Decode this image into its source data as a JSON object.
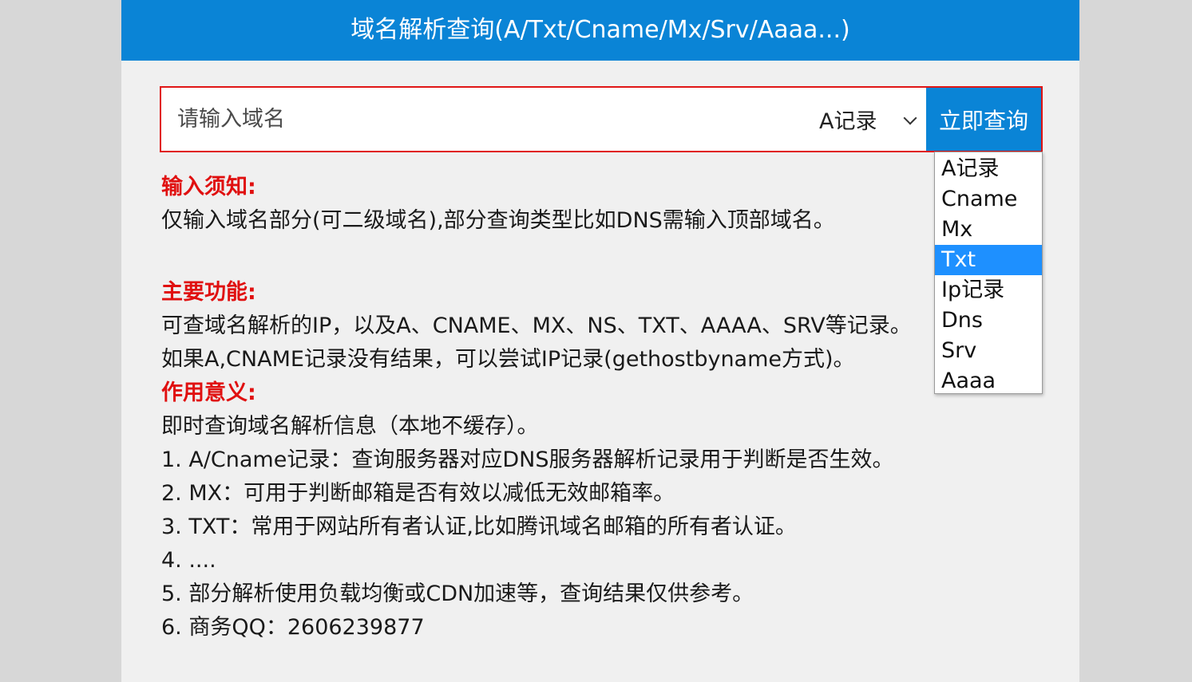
{
  "header": {
    "title": "域名解析查询(A/Txt/Cname/Mx/Srv/Aaaa...)"
  },
  "search": {
    "placeholder": "请输入域名",
    "value": "",
    "record_type_selected": "A记录",
    "button_label": "立即查询"
  },
  "dropdown": {
    "options": [
      "A记录",
      "Cname",
      "Mx",
      "Txt",
      "Ip记录",
      "Dns",
      "Srv",
      "Aaaa"
    ],
    "highlighted": "Txt"
  },
  "content": {
    "notice_heading": "输入须知:",
    "notice_text": "仅输入域名部分(可二级域名),部分查询类型比如DNS需输入顶部域名。",
    "features_heading": "主要功能:",
    "features_line1": "可查域名解析的IP，以及A、CNAME、MX、NS、TXT、AAAA、SRV等记录。",
    "features_line2": "如果A,CNAME记录没有结果，可以尝试IP记录(gethostbyname方式)。",
    "purpose_heading": "作用意义:",
    "purpose_lines": [
      "即时查询域名解析信息（本地不缓存）。",
      "1. A/Cname记录：查询服务器对应DNS服务器解析记录用于判断是否生效。",
      "2. MX：可用于判断邮箱是否有效以减低无效邮箱率。",
      "3. TXT：常用于网站所有者认证,比如腾讯域名邮箱的所有者认证。",
      "4. ....",
      "5. 部分解析使用负载均衡或CDN加速等，查询结果仅供参考。",
      "6. 商务QQ：2606239877"
    ]
  },
  "colors": {
    "primary": "#0a84d6",
    "heading_red": "#e01010",
    "border_red": "#e01515",
    "highlight": "#1e90ff"
  }
}
